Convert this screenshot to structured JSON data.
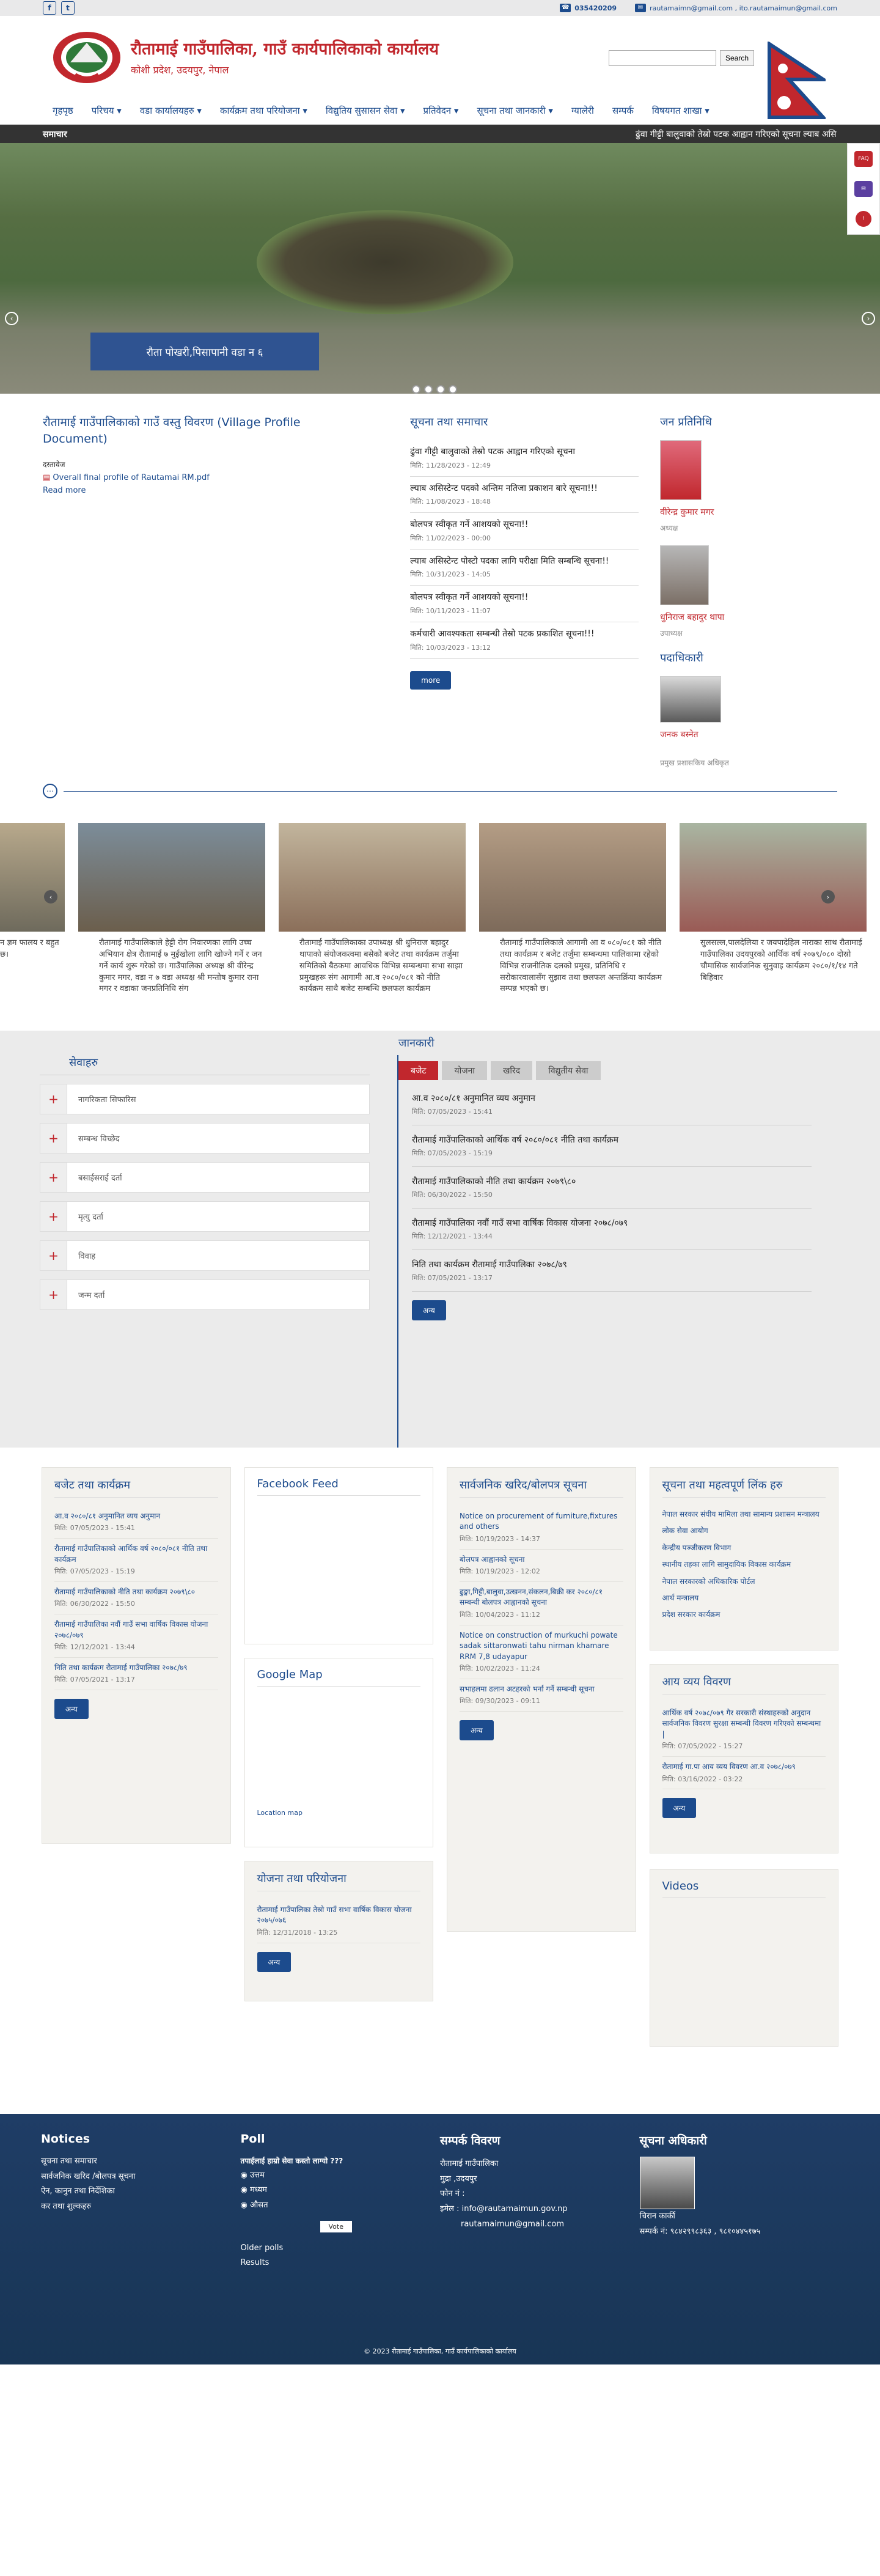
{
  "topbar": {
    "phone": "035420209",
    "email": "rautamaimn@gmail.com , ito.rautamaimun@gmail.com",
    "fb": "f",
    "tw": "t"
  },
  "header": {
    "title": "रौतामाई गाउँपालिका, गाउँ कार्यपालिकाको कार्यालय",
    "subtitle": "कोशी प्रदेश, उदयपुर, नेपाल",
    "search_placeholder": "",
    "search_button": "Search"
  },
  "nav": [
    "गृहपृष्ठ",
    "परिचय ▾",
    "वडा कार्यालयहरु ▾",
    "कार्यक्रम तथा परियोजना ▾",
    "विद्युतिय सुसासन सेवा ▾",
    "प्रतिवेदन ▾",
    "सूचना तथा जानकारी ▾",
    "ग्यालेरी",
    "सम्पर्क",
    "विषयगत शाखा ▾"
  ],
  "ticker": {
    "label": "समाचार",
    "message": "ढुंवा गीट्टी बालुवाको तेस्रो पटक आह्वान गरिएको सूचना    ल्याब असि"
  },
  "slider": {
    "caption": "रौता पोखरी,पिसापानी वडा न ६"
  },
  "profile": {
    "title": "रौतामाई गाउँपालिकाको गाउँ वस्तु विवरण (Village Profile Document)",
    "doc_label": "दस्तावेज",
    "doc_link": "Overall final profile of Rautamai RM.pdf",
    "read_more": "Read more"
  },
  "news": {
    "heading": "सूचना तथा समाचार",
    "items": [
      {
        "t": "ढुंवा गीट्टी बालुवाको तेस्रो पटक आह्वान गरिएको सूचना",
        "d": "मिति: 11/28/2023 - 12:49"
      },
      {
        "t": "ल्याब असिस्टेन्ट पदको अन्तिम नतिजा प्रकाशन बारे सूचना!!!",
        "d": "मिति: 11/08/2023 - 18:48"
      },
      {
        "t": "बोलपत्र स्वीकृत गर्ने आशयको सूचना!!",
        "d": "मिति: 11/02/2023 - 00:00"
      },
      {
        "t": "ल्याब असिस्टेन्ट पोस्टो पदका लागि परीक्षा मिति सम्बन्धि सूचना!!",
        "d": "मिति: 10/31/2023 - 14:05"
      },
      {
        "t": "बोलपत्र स्वीकृत गर्ने आशयको सूचना!!",
        "d": "मिति: 10/11/2023 - 11:07"
      },
      {
        "t": "कर्मचारी आवश्यकता सम्बन्धी तेस्रो पटक प्रकाशित सूचना!!!",
        "d": "मिति: 10/03/2023 - 13:12"
      }
    ],
    "more": "more"
  },
  "reps": {
    "heading": "जन प्रतिनिधि",
    "items": [
      {
        "name": "वीरेन्द्र कुमार मगर",
        "role": "अध्यक्ष"
      },
      {
        "name": "धुनिराज बहादुर थापा",
        "role": "उपाध्यक्ष"
      }
    ],
    "officer_heading": "पदाधिकारी",
    "officer": {
      "name": "जनक बस्नेत",
      "role": "प्रमुख प्रशासकिय अधिकृत"
    }
  },
  "gallery": [
    {
      "cap": "न ज्ञम फालय र बहुत छ।"
    },
    {
      "cap": "रौतामाई गाउँपालिकाले हेट्टी रोग निवारणका लागि उच्च अभियान क्षेत्र रौतामाई ७ मुईखोला लागि खोज्ने गर्ने र जन गर्ने कार्य शुरू गरेको छ। गाउँपालिका अध्यक्ष श्री वीरेन्द्र कुमार मगर, वडा न ७ वडा अध्यक्ष श्री मन्तोष कुमार राना मगर र वडाका जनप्रतिनिधि संग"
    },
    {
      "cap": "रौतामाई गाउँपालिकाका उपाध्यक्ष श्री धुनिराज बहादुर थापाको संयोजकत्वमा बसेको बजेट तथा कार्यक्रम तर्जुमा समितिको बैठकमा आवधिक विभिन्न सम्बन्धमा सभा साझा प्रमुखहरू संग आगामी आ.व २०८०/०८१ को नीति कार्यक्रम साथै बजेट सम्बन्धि छलफल कार्यक्रम"
    },
    {
      "cap": "रौतामाई गाउँपालिकाले आगामी आ व ०८०/०८१ को नीति तथा कार्यक्रम र बजेट तर्जुमा सम्बन्धमा पालिकामा रहेको विभिन्न राजनीतिक दलको प्रमुख, प्रतिनिधि र सरोकारवालासँग सुझाव तथा छलफल अन्तर्क्रिया कार्यक्रम सम्पन्न भएको छ।"
    },
    {
      "cap": "सुलसल्ल,पालदेलिया र जयपादेहिल नाराका साथ रौतामाई गाउँपालिका उदयपुरको आर्थिक वर्ष २०७९/०८० दोस्रो चौमासिक सार्वजनिक सुनुवाइ कार्यक्रम २०८०/१/१४ गते बिहिवार"
    }
  ],
  "services": {
    "heading": "सेवाहरु",
    "items": [
      "नागरिकता सिफारिस",
      "सम्बन्ध विच्छेद",
      "बसाईसराई दर्ता",
      "मृत्यु दर्ता",
      "विवाह",
      "जन्म दर्ता"
    ]
  },
  "jankari": {
    "heading": "जानकारी",
    "tabs": [
      "बजेट",
      "योजना",
      "खरिद",
      "विद्युतीय सेवा"
    ],
    "items": [
      {
        "t": "आ.व २०८०/८१ अनुमानित व्यय अनुमान",
        "d": "मिति: 07/05/2023 - 15:41"
      },
      {
        "t": "रौतामाई गाउँपालिकाको आर्थिक वर्ष २०८०/०८१ नीति तथा कार्यक्रम",
        "d": "मिति: 07/05/2023 - 15:19"
      },
      {
        "t": "रौतामाई गाउँपालिकाको नीति तथा कार्यक्रम २०७९\\८०",
        "d": "मिति: 06/30/2022 - 15:50"
      },
      {
        "t": "रौतामाई गाउँपालिका नवौं गाउँ सभा वार्षिक विकास योजना २०७८/०७९",
        "d": "मिति: 12/12/2021 - 13:44"
      },
      {
        "t": "निति तथा कार्यक्रम रौतामाई गाउँपालिका २०७८/७९",
        "d": "मिति: 07/05/2021 - 13:17"
      }
    ],
    "more": "अन्य"
  },
  "budget_box": {
    "heading": "बजेट तथा कार्यक्रम",
    "items": [
      {
        "t": "आ.व २०८०/८१ अनुमानित व्यय अनुमान",
        "d": "मिति: 07/05/2023 - 15:41"
      },
      {
        "t": "रौतामाई गाउँपालिकाको आर्थिक वर्ष २०८०/०८१ नीति तथा कार्यक्रम",
        "d": "मिति: 07/05/2023 - 15:19"
      },
      {
        "t": "रौतामाई गाउँपालिकाको नीति तथा कार्यक्रम २०७९\\८०",
        "d": "मिति: 06/30/2022 - 15:50"
      },
      {
        "t": "रौतामाई गाउँपालिका नवौं गाउँ सभा वार्षिक विकास योजना २०७८/०७९",
        "d": "मिति: 12/12/2021 - 13:44"
      },
      {
        "t": "निति तथा कार्यक्रम रौतामाई गाउँपालिका २०७८/७९",
        "d": "मिति: 07/05/2021 - 13:17"
      }
    ],
    "more": "अन्य"
  },
  "facebook": {
    "heading": "Facebook Feed"
  },
  "map": {
    "heading": "Google Map",
    "alt": "Location map"
  },
  "yojana": {
    "heading": "योजना तथा परियोजना",
    "items": [
      {
        "t": "रौतामाई गाउँपालिका तेस्रो गाउँ सभा वार्षिक विकास योजना २०७५/०७६",
        "d": "मिति: 12/31/2018 - 13:25"
      }
    ],
    "more": "अन्य"
  },
  "procure": {
    "heading": "सार्वजनिक खरिद/बोलपत्र सूचना",
    "items": [
      {
        "t": "Notice on procurement of furniture,fixtures and others",
        "d": "मिति: 10/19/2023 - 14:37"
      },
      {
        "t": "बोलपत्र आह्वानको सूचना",
        "d": "मिति: 10/19/2023 - 12:02"
      },
      {
        "t": "ढुङ्गा,गिट्टी,बालुवा,उत्खनन,संकलन,बिक्री कर २०८०/८१ सम्बन्धी बोलपत्र आह्वानको सूचना",
        "d": "मिति: 10/04/2023 - 11:12"
      },
      {
        "t": "Notice on construction of murkuchi powate sadak sittaronwati tahu nirman khamare RRM 7,8 udayapur",
        "d": "मिति: 10/02/2023 - 11:24"
      },
      {
        "t": "सभाहलमा ढलान अटहरको भर्ना गर्ने सम्बन्धी सूचना",
        "d": "मिति: 09/30/2023 - 09:11"
      }
    ],
    "more": "अन्य"
  },
  "links": {
    "heading": "सूचना तथा महत्वपूर्ण लिंक हरु",
    "items": [
      "नेपाल सरकार संघीय मामिला तथा सामान्य प्रशासन मन्त्रालय",
      "लोक सेवा आयोग",
      "केन्द्रीय पञ्जीकरण विभाग",
      "स्थानीय तहका लागि सामुदायिक विकास कार्यक्रम",
      "नेपाल सरकारको अधिकारिक पोर्टल",
      "आर्थ मन्त्रालय",
      "प्रदेश सरकार कार्यक्रम"
    ]
  },
  "ayavyaya": {
    "heading": "आय व्यय विवरण",
    "items": [
      {
        "t": "आर्थिक वर्ष २०७८/०७९ गैर सरकारी संस्थाहरुको अनुदान सार्वजनिक विवरण सुरक्षा सम्बन्धी विवरण गरिएको सम्बन्धमा |",
        "d": "मिति: 07/05/2022 - 15:27"
      },
      {
        "t": "रौतामाई गा.पा आय व्यय विवरण आ.व २०७८/०७९",
        "d": "मिति: 03/16/2022 - 03:22"
      }
    ],
    "more": "अन्य"
  },
  "videos": {
    "heading": "Videos"
  },
  "footer": {
    "notices_h": "Notices",
    "notices": [
      "सूचना तथा समाचार",
      "सार्वजनिक खरिद /बोलपत्र सूचना",
      "ऐन, कानुन तथा निर्देशिका",
      "कर तथा शुल्कहरु"
    ],
    "poll_h": "Poll",
    "poll_q": "तपाईलाई हाम्रो सेवा कस्तो लाग्यो ???",
    "poll_opts": [
      "उत्तम",
      "मध्यम",
      "औसत"
    ],
    "poll_vote": "Vote",
    "older": "Older polls",
    "results": "Results",
    "contact_h": "सम्पर्क विवरण",
    "contact": [
      "रौतामाई गाउँपालिका",
      "मुद्रा ,उदयपुर",
      "फोन नं :",
      "इमेल : info@rautamaimun.gov.np",
      "rautamaimun@gmail.com"
    ],
    "officer_h": "सूचना अधिकारी",
    "officer_name": "चिरान कार्की",
    "officer_phone": "सम्पर्क नं: ९८४२९९८३६३ , ९८१०४४५१७५",
    "copyright": "© 2023 रौतामाई गाउँपालिका, गाउँ कार्यपालिकाको कार्यालय"
  }
}
